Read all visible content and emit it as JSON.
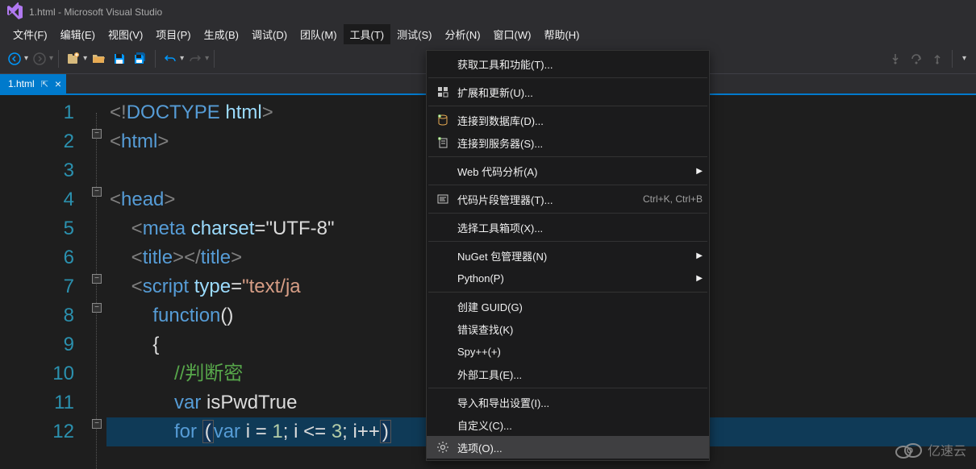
{
  "title": "1.html - Microsoft Visual Studio",
  "menus": [
    "文件(F)",
    "编辑(E)",
    "视图(V)",
    "项目(P)",
    "生成(B)",
    "调试(D)",
    "团队(M)",
    "工具(T)",
    "测试(S)",
    "分析(N)",
    "窗口(W)",
    "帮助(H)"
  ],
  "open_menu_index": 7,
  "tab": {
    "name": "1.html"
  },
  "dropdown": {
    "items": [
      {
        "label": "获取工具和功能(T)...",
        "icon": "",
        "shortcut": "",
        "arrow": false
      },
      {
        "sep": true
      },
      {
        "label": "扩展和更新(U)...",
        "icon": "extensions",
        "shortcut": "",
        "arrow": false
      },
      {
        "sep": true
      },
      {
        "label": "连接到数据库(D)...",
        "icon": "database",
        "shortcut": "",
        "arrow": false
      },
      {
        "label": "连接到服务器(S)...",
        "icon": "server",
        "shortcut": "",
        "arrow": false
      },
      {
        "sep": true
      },
      {
        "label": "Web 代码分析(A)",
        "icon": "",
        "shortcut": "",
        "arrow": true
      },
      {
        "sep": true
      },
      {
        "label": "代码片段管理器(T)...",
        "icon": "snippet",
        "shortcut": "Ctrl+K, Ctrl+B",
        "arrow": false
      },
      {
        "sep": true
      },
      {
        "label": "选择工具箱项(X)...",
        "icon": "",
        "shortcut": "",
        "arrow": false
      },
      {
        "sep": true
      },
      {
        "label": "NuGet 包管理器(N)",
        "icon": "",
        "shortcut": "",
        "arrow": true
      },
      {
        "label": "Python(P)",
        "icon": "",
        "shortcut": "",
        "arrow": true
      },
      {
        "sep": true
      },
      {
        "label": "创建 GUID(G)",
        "icon": "",
        "shortcut": "",
        "arrow": false
      },
      {
        "label": "错误查找(K)",
        "icon": "",
        "shortcut": "",
        "arrow": false
      },
      {
        "label": "Spy++(+)",
        "icon": "",
        "shortcut": "",
        "arrow": false
      },
      {
        "label": "外部工具(E)...",
        "icon": "",
        "shortcut": "",
        "arrow": false
      },
      {
        "sep": true
      },
      {
        "label": "导入和导出设置(I)...",
        "icon": "",
        "shortcut": "",
        "arrow": false
      },
      {
        "label": "自定义(C)...",
        "icon": "",
        "shortcut": "",
        "arrow": false
      },
      {
        "label": "选项(O)...",
        "icon": "gear",
        "shortcut": "",
        "arrow": false,
        "hover": true
      }
    ]
  },
  "code": {
    "lines": [
      {
        "n": 1,
        "segs": [
          {
            "t": "<!",
            "c": "p-gray"
          },
          {
            "t": "DOCTYPE",
            "c": "p-blue"
          },
          {
            "t": " ",
            "c": ""
          },
          {
            "t": "html",
            "c": "p-ltblue"
          },
          {
            "t": ">",
            "c": "p-gray"
          }
        ]
      },
      {
        "n": 2,
        "segs": [
          {
            "t": "<",
            "c": "p-gray"
          },
          {
            "t": "html",
            "c": "p-blue"
          },
          {
            "t": ">",
            "c": "p-gray"
          }
        ]
      },
      {
        "n": 3,
        "segs": []
      },
      {
        "n": 4,
        "segs": [
          {
            "t": "<",
            "c": "p-gray"
          },
          {
            "t": "head",
            "c": "p-blue"
          },
          {
            "t": ">",
            "c": "p-gray"
          }
        ]
      },
      {
        "n": 5,
        "segs": [
          {
            "t": "    ",
            "c": ""
          },
          {
            "t": "<",
            "c": "p-gray"
          },
          {
            "t": "meta",
            "c": "p-blue"
          },
          {
            "t": " ",
            "c": ""
          },
          {
            "t": "charset",
            "c": "p-ltblue"
          },
          {
            "t": "=\"UTF-8\"",
            "c": "p-white"
          }
        ]
      },
      {
        "n": 6,
        "segs": [
          {
            "t": "    ",
            "c": ""
          },
          {
            "t": "<",
            "c": "p-gray"
          },
          {
            "t": "title",
            "c": "p-blue"
          },
          {
            "t": "></",
            "c": "p-gray"
          },
          {
            "t": "title",
            "c": "p-blue"
          },
          {
            "t": ">",
            "c": "p-gray"
          }
        ]
      },
      {
        "n": 7,
        "segs": [
          {
            "t": "    ",
            "c": ""
          },
          {
            "t": "<",
            "c": "p-gray"
          },
          {
            "t": "script",
            "c": "p-blue"
          },
          {
            "t": " ",
            "c": ""
          },
          {
            "t": "type",
            "c": "p-ltblue"
          },
          {
            "t": "=",
            "c": "p-white"
          },
          {
            "t": "\"text/ja",
            "c": "p-str"
          }
        ]
      },
      {
        "n": 8,
        "segs": [
          {
            "t": "        ",
            "c": ""
          },
          {
            "t": "function",
            "c": "p-blue"
          },
          {
            "t": "()",
            "c": "p-white"
          }
        ]
      },
      {
        "n": 9,
        "segs": [
          {
            "t": "        {",
            "c": "p-white"
          }
        ]
      },
      {
        "n": 10,
        "segs": [
          {
            "t": "            ",
            "c": ""
          },
          {
            "t": "//判断密",
            "c": "p-green"
          }
        ]
      },
      {
        "n": 11,
        "segs": [
          {
            "t": "            ",
            "c": ""
          },
          {
            "t": "var",
            "c": "p-blue"
          },
          {
            "t": " isPwdTrue",
            "c": "p-white"
          }
        ]
      },
      {
        "n": 12,
        "hl": true,
        "segs": [
          {
            "t": "            ",
            "c": ""
          },
          {
            "t": "for",
            "c": "p-blue"
          },
          {
            "t": " ",
            "c": ""
          },
          {
            "t": "(",
            "c": "paren-box"
          },
          {
            "t": "var",
            "c": "p-blue"
          },
          {
            "t": " i ",
            "c": "p-white"
          },
          {
            "t": "=",
            "c": "p-white"
          },
          {
            "t": " ",
            "c": ""
          },
          {
            "t": "1",
            "c": "p-num"
          },
          {
            "t": "; i ",
            "c": "p-white"
          },
          {
            "t": "<=",
            "c": "p-white"
          },
          {
            "t": " ",
            "c": ""
          },
          {
            "t": "3",
            "c": "p-num"
          },
          {
            "t": "; i",
            "c": "p-white"
          },
          {
            "t": "++",
            "c": "p-white"
          },
          {
            "t": ")",
            "c": "paren-box"
          }
        ]
      }
    ]
  },
  "watermark": "亿速云"
}
